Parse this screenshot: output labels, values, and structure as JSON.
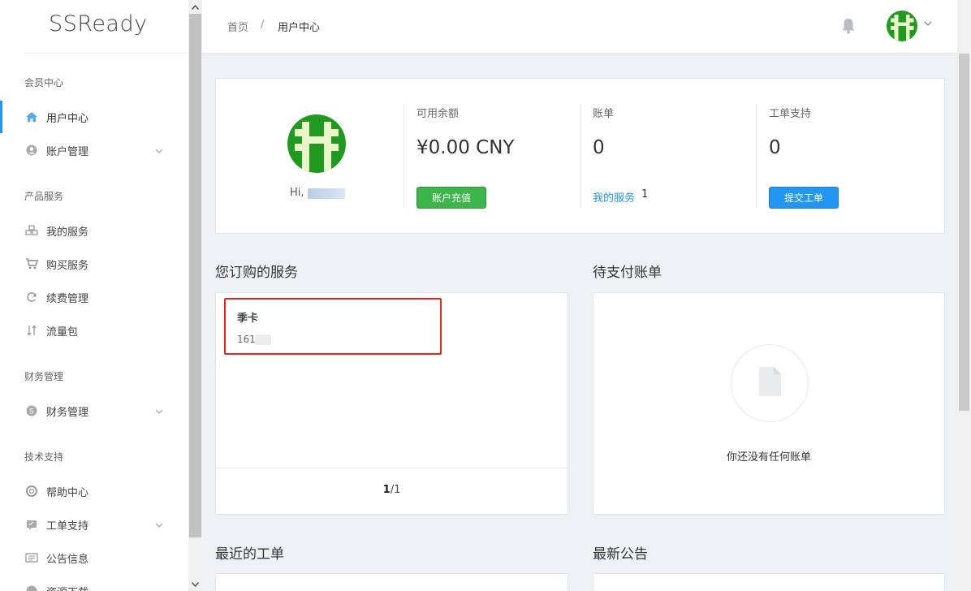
{
  "app": {
    "logo": "SSReady"
  },
  "sidebar": {
    "sections": [
      {
        "title": "会员中心"
      },
      {
        "title": "产品服务"
      },
      {
        "title": "财务管理"
      },
      {
        "title": "技术支持"
      }
    ],
    "items": [
      {
        "label": "用户中心",
        "icon": "home-icon"
      },
      {
        "label": "账户管理",
        "icon": "user-icon"
      },
      {
        "label": "我的服务",
        "icon": "cubes-icon"
      },
      {
        "label": "购买服务",
        "icon": "cart-icon"
      },
      {
        "label": "续费管理",
        "icon": "refresh-icon"
      },
      {
        "label": "流量包",
        "icon": "transfer-icon"
      },
      {
        "label": "财务管理",
        "icon": "dollar-icon"
      },
      {
        "label": "帮助中心",
        "icon": "lifebuoy-icon"
      },
      {
        "label": "工单支持",
        "icon": "ticket-icon"
      },
      {
        "label": "公告信息",
        "icon": "announcement-icon"
      },
      {
        "label": "资源下载",
        "icon": "download-icon"
      }
    ]
  },
  "header": {
    "breadcrumb_home": "首页",
    "breadcrumb_sep": "/",
    "breadcrumb_current": "用户中心"
  },
  "profile": {
    "greeting": "Hi,",
    "balance_title": "可用余额",
    "balance_value": "¥0.00 CNY",
    "recharge_button": "账户充值",
    "bills_title": "账单",
    "bills_value": "0",
    "my_services_link": "我的服务",
    "my_services_count": "1",
    "tickets_title": "工单支持",
    "tickets_value": "0",
    "submit_ticket_button": "提交工单"
  },
  "services": {
    "title": "您订购的服务",
    "items": [
      {
        "name": "季卡",
        "id": "161"
      }
    ],
    "pager_current": "1",
    "pager_total": "/1"
  },
  "bills": {
    "title": "待支付账单",
    "empty_text": "你还没有任何账单"
  },
  "recent_tickets": {
    "title": "最近的工单"
  },
  "announcements": {
    "title": "最新公告"
  },
  "colors": {
    "accent": "#2196f3",
    "success": "#3cb64a",
    "highlight": "#e3261f",
    "avatar_green": "#1f9a1f"
  }
}
